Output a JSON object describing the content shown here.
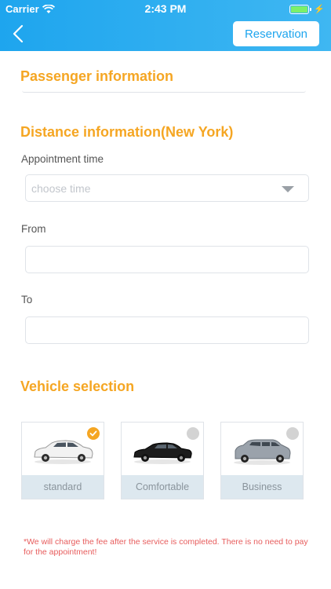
{
  "status_bar": {
    "carrier": "Carrier",
    "time": "2:43 PM"
  },
  "nav": {
    "reservation_label": "Reservation"
  },
  "passenger": {
    "title": "Passenger information"
  },
  "distance": {
    "title": "Distance information(New York)",
    "appointment_label": "Appointment time",
    "appointment_placeholder": "choose time",
    "from_label": "From",
    "from_value": "",
    "to_label": "To",
    "to_value": ""
  },
  "vehicle": {
    "title": "Vehicle selection",
    "options": [
      {
        "label": "standard",
        "selected": true
      },
      {
        "label": "Comfortable",
        "selected": false
      },
      {
        "label": "Business",
        "selected": false
      }
    ]
  },
  "notice": "*We will charge the fee after the service is completed. There is no need to pay for the appointment!",
  "colors": {
    "header": "#1ea5ee",
    "accent": "#f5a623",
    "notice": "#e75c5c"
  }
}
